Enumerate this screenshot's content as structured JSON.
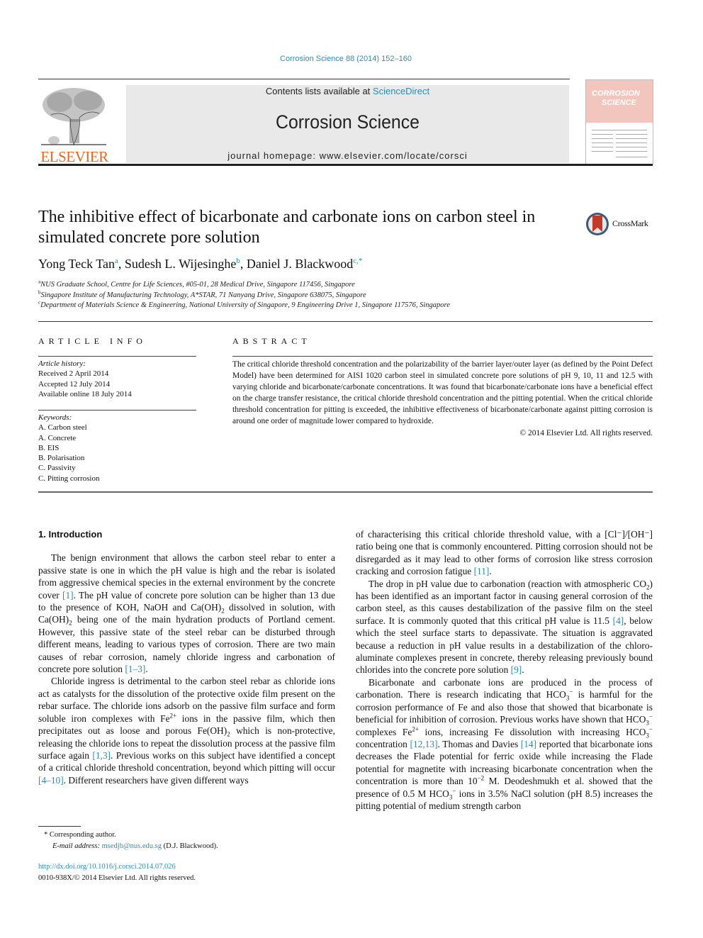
{
  "header": {
    "citation": "Corrosion Science 88 (2014) 152–160",
    "publisher_logo_text": "ELSEVIER",
    "contents_prefix": "Contents lists available at ",
    "contents_link": "ScienceDirect",
    "journal_title": "Corrosion Science",
    "homepage": "journal homepage: www.elsevier.com/locate/corsci",
    "cover_title_line1": "CORROSION",
    "cover_title_line2": "SCIENCE",
    "crossmark_label": "CrossMark"
  },
  "article": {
    "title": "The inhibitive effect of bicarbonate and carbonate ions on carbon steel in simulated concrete pore solution",
    "authors": [
      {
        "name": "Yong Teck Tan",
        "sup": "a"
      },
      {
        "name": "Sudesh L. Wijesinghe",
        "sup": "b"
      },
      {
        "name": "Daniel J. Blackwood",
        "sup": "c,*"
      }
    ],
    "affiliations": [
      {
        "sup": "a",
        "text": "NUS Graduate School, Centre for Life Sciences, #05-01, 28 Medical Drive, Singapore 117456, Singapore"
      },
      {
        "sup": "b",
        "text": "Singapore Institute of Manufacturing Technology, A*STAR, 71 Nanyang Drive, Singapore 638075, Singapore"
      },
      {
        "sup": "c",
        "text": "Department of Materials Science & Engineering, National University of Singapore, 9 Engineering Drive 1, Singapore 117576, Singapore"
      }
    ]
  },
  "article_info": {
    "heading": "ARTICLE INFO",
    "history_label": "Article history:",
    "history": [
      "Received 2 April 2014",
      "Accepted 12 July 2014",
      "Available online 18 July 2014"
    ],
    "keywords_label": "Keywords:",
    "keywords": [
      "A. Carbon steel",
      "A. Concrete",
      "B. EIS",
      "B. Polarisation",
      "C. Passivity",
      "C. Pitting corrosion"
    ]
  },
  "abstract": {
    "heading": "ABSTRACT",
    "body": "The critical chloride threshold concentration and the polarizability of the barrier layer/outer layer (as defined by the Point Defect Model) have been determined for AISI 1020 carbon steel in simulated concrete pore solutions of pH 9, 10, 11 and 12.5 with varying chloride and bicarbonate/carbonate concentrations. It was found that bicarbonate/carbonate ions have a beneficial effect on the charge transfer resistance, the critical chloride threshold concentration and the pitting potential. When the critical chloride threshold concentration for pitting is exceeded, the inhibitive effectiveness of bicarbonate/carbonate against pitting corrosion is around one order of magnitude lower compared to hydroxide.",
    "copyright": "© 2014 Elsevier Ltd. All rights reserved."
  },
  "intro": {
    "heading": "1. Introduction",
    "p1": {
      "a": "The benign environment that allows the carbon steel rebar to enter a passive state is one in which the pH value is high and the rebar is isolated from aggressive chemical species in the external environment by the concrete cover ",
      "ref1": "[1]",
      "b": ". The pH value of concrete pore solution can be higher than 13 due to the presence of KOH, NaOH and Ca(OH)",
      "sub1": "2",
      "c": " dissolved in solution, with Ca(OH)",
      "sub2": "2",
      "d": " being one of the main hydration products of Portland cement. However, this passive state of the steel rebar can be disturbed through different means, leading to various types of corrosion. There are two main causes of rebar corrosion, namely chloride ingress and carbonation of concrete pore solution ",
      "ref2": "[1–3]",
      "e": "."
    },
    "p2": {
      "a": "Chloride ingress is detrimental to the carbon steel rebar as chloride ions act as catalysts for the dissolution of the protective oxide film present on the rebar surface. The chloride ions adsorb on the passive film surface and form soluble iron complexes with Fe",
      "sup1": "2+",
      "b": " ions in the passive film, which then precipitates out as loose and porous Fe(OH)",
      "sub1": "2",
      "c": " which is non-protective, releasing the chloride ions to repeat the dissolution process at the passive film surface again ",
      "ref1": "[1,3]",
      "d": ". Previous works on this subject have identified a concept of a critical chloride threshold concentration, beyond which pitting will occur ",
      "ref2": "[4–10]",
      "e": ". Different researchers have given different ways"
    },
    "p3": {
      "a": "of characterising this critical chloride threshold value, with a [Cl⁻]/[OH⁻] ratio being one that is commonly encountered. Pitting corrosion should not be disregarded as it may lead to other forms of corrosion like stress corrosion cracking and corrosion fatigue ",
      "ref1": "[11]",
      "b": "."
    },
    "p4": {
      "a": "The drop in pH value due to carbonation (reaction with atmospheric CO",
      "sub1": "2",
      "b": ") has been identified as an important factor in causing general corrosion of the carbon steel, as this causes destabilization of the passive film on the steel surface. It is commonly quoted that this critical pH value is 11.5 ",
      "ref1": "[4]",
      "c": ", below which the steel surface starts to depassivate. The situation is aggravated because a reduction in pH value results in a destabilization of the chloro-aluminate complexes present in concrete, thereby releasing previously bound chlorides into the concrete pore solution ",
      "ref2": "[9]",
      "d": "."
    },
    "p5": {
      "a": "Bicarbonate and carbonate ions are produced in the process of carbonation. There is research indicating that HCO",
      "sub1": "3",
      "sup1": "−",
      "b": " is harmful for the corrosion performance of Fe and also those that showed that bicarbonate is beneficial for inhibition of corrosion. Previous works have shown that HCO",
      "sub2": "3",
      "sup2": "−",
      "c": " complexes Fe",
      "sup3": "2+",
      "d": " ions, increasing Fe dissolution with increasing HCO",
      "sub3": "3",
      "sup4": "−",
      "e": " concentration ",
      "ref1": "[12,13]",
      "f": ". Thomas and Davies ",
      "ref2": "[14]",
      "g": " reported that bicarbonate ions decreases the Flade potential for ferric oxide while increasing the Flade potential for magnetite with increasing bicarbonate concentration when the concentration is more than 10",
      "sup5": "−2",
      "h": " M. Deodeshmukh et al. showed that the presence of 0.5 M HCO",
      "sub4": "3",
      "sup6": "−",
      "i": " ions in 3.5% NaCl solution (pH 8.5) increases the pitting potential of medium strength carbon"
    }
  },
  "footnotes": {
    "corresponding": "* Corresponding author.",
    "email_label": "E-mail address: ",
    "email": "msedjb@nus.edu.sg",
    "email_suffix": " (D.J. Blackwood).",
    "doi": "http://dx.doi.org/10.1016/j.corsci.2014.07.026",
    "issn": "0010-938X/© 2014 Elsevier Ltd. All rights reserved."
  },
  "colors": {
    "link": "#2c8cb8",
    "elsevier_orange": "#e8671c",
    "header_gray": "#e9e9e9",
    "cover_pink": "#f2c6bd"
  }
}
